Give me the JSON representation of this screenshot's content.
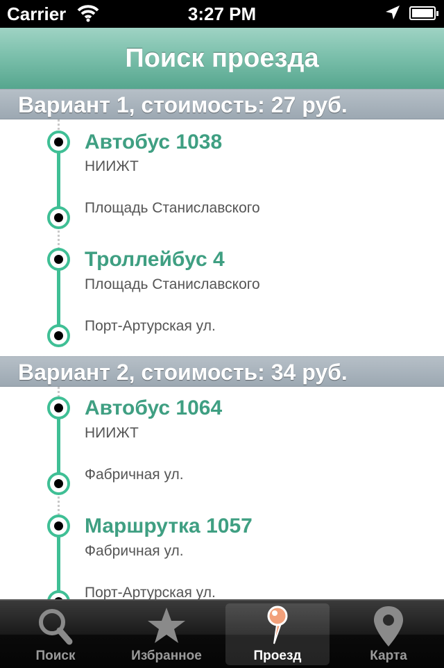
{
  "status_bar": {
    "carrier": "Carrier",
    "time": "3:27 PM",
    "icons": [
      "wifi-icon",
      "location-arrow-icon",
      "battery-icon"
    ]
  },
  "nav": {
    "title": "Поиск проезда"
  },
  "options": [
    {
      "header": "Вариант 1, стоимость: 27 руб.",
      "legs": [
        {
          "route": "Автобус 1038",
          "from": "НИИЖТ",
          "to": "Площадь Станиславского"
        },
        {
          "route": "Троллейбус 4",
          "from": "Площадь Станиславского",
          "to": "Порт-Артурская ул."
        }
      ]
    },
    {
      "header": "Вариант 2, стоимость: 34 руб.",
      "legs": [
        {
          "route": "Автобус 1064",
          "from": "НИИЖТ",
          "to": "Фабричная ул."
        },
        {
          "route": "Маршрутка 1057",
          "from": "Фабричная ул.",
          "to": "Порт-Артурская ул."
        }
      ]
    }
  ],
  "tabs": [
    {
      "label": "Поиск",
      "icon": "search-icon",
      "selected": false
    },
    {
      "label": "Избранное",
      "icon": "star-icon",
      "selected": false
    },
    {
      "label": "Проезд",
      "icon": "pin-icon",
      "selected": true
    },
    {
      "label": "Карта",
      "icon": "map-pin-icon",
      "selected": false
    }
  ],
  "colors": {
    "accent": "#3fbf95",
    "route_title": "#3f9f82",
    "nav_bar": "#7cc0ac",
    "section_header": "#a3aeb8",
    "tab_selected_icon": "#f2a07a"
  }
}
